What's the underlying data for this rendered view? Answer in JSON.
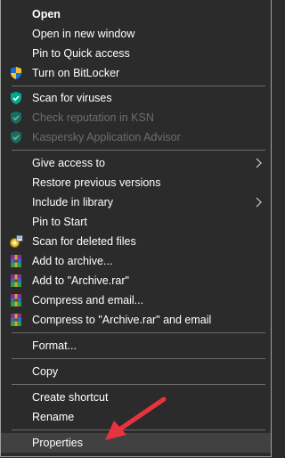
{
  "menu": {
    "items": [
      {
        "label": "Open"
      },
      {
        "label": "Open in new window"
      },
      {
        "label": "Pin to Quick access"
      },
      {
        "label": "Turn on BitLocker",
        "icon": "shield-uac-icon"
      },
      {
        "label": "Scan for viruses",
        "icon": "kaspersky-shield-icon"
      },
      {
        "label": "Check reputation in KSN",
        "icon": "kaspersky-shield-icon",
        "disabled": true
      },
      {
        "label": "Kaspersky Application Advisor",
        "icon": "kaspersky-shield-icon",
        "disabled": true
      },
      {
        "label": "Give access to",
        "submenu": true
      },
      {
        "label": "Restore previous versions"
      },
      {
        "label": "Include in library",
        "submenu": true
      },
      {
        "label": "Pin to Start"
      },
      {
        "label": "Scan for deleted files",
        "icon": "recovery-icon"
      },
      {
        "label": "Add to archive...",
        "icon": "winrar-icon"
      },
      {
        "label": "Add to \"Archive.rar\"",
        "icon": "winrar-icon"
      },
      {
        "label": "Compress and email...",
        "icon": "winrar-icon"
      },
      {
        "label": "Compress to \"Archive.rar\" and email",
        "icon": "winrar-icon"
      },
      {
        "label": "Format..."
      },
      {
        "label": "Copy"
      },
      {
        "label": "Create shortcut"
      },
      {
        "label": "Rename"
      },
      {
        "label": "Properties",
        "highlighted": true
      }
    ]
  },
  "colors": {
    "background": "#2b2b2b",
    "highlight": "#414141",
    "text": "#ffffff",
    "disabled_text": "#6d6d6d",
    "separator": "#6b6b6b",
    "annotation_arrow": "#e8333f",
    "kaspersky_green": "#00a88e"
  }
}
